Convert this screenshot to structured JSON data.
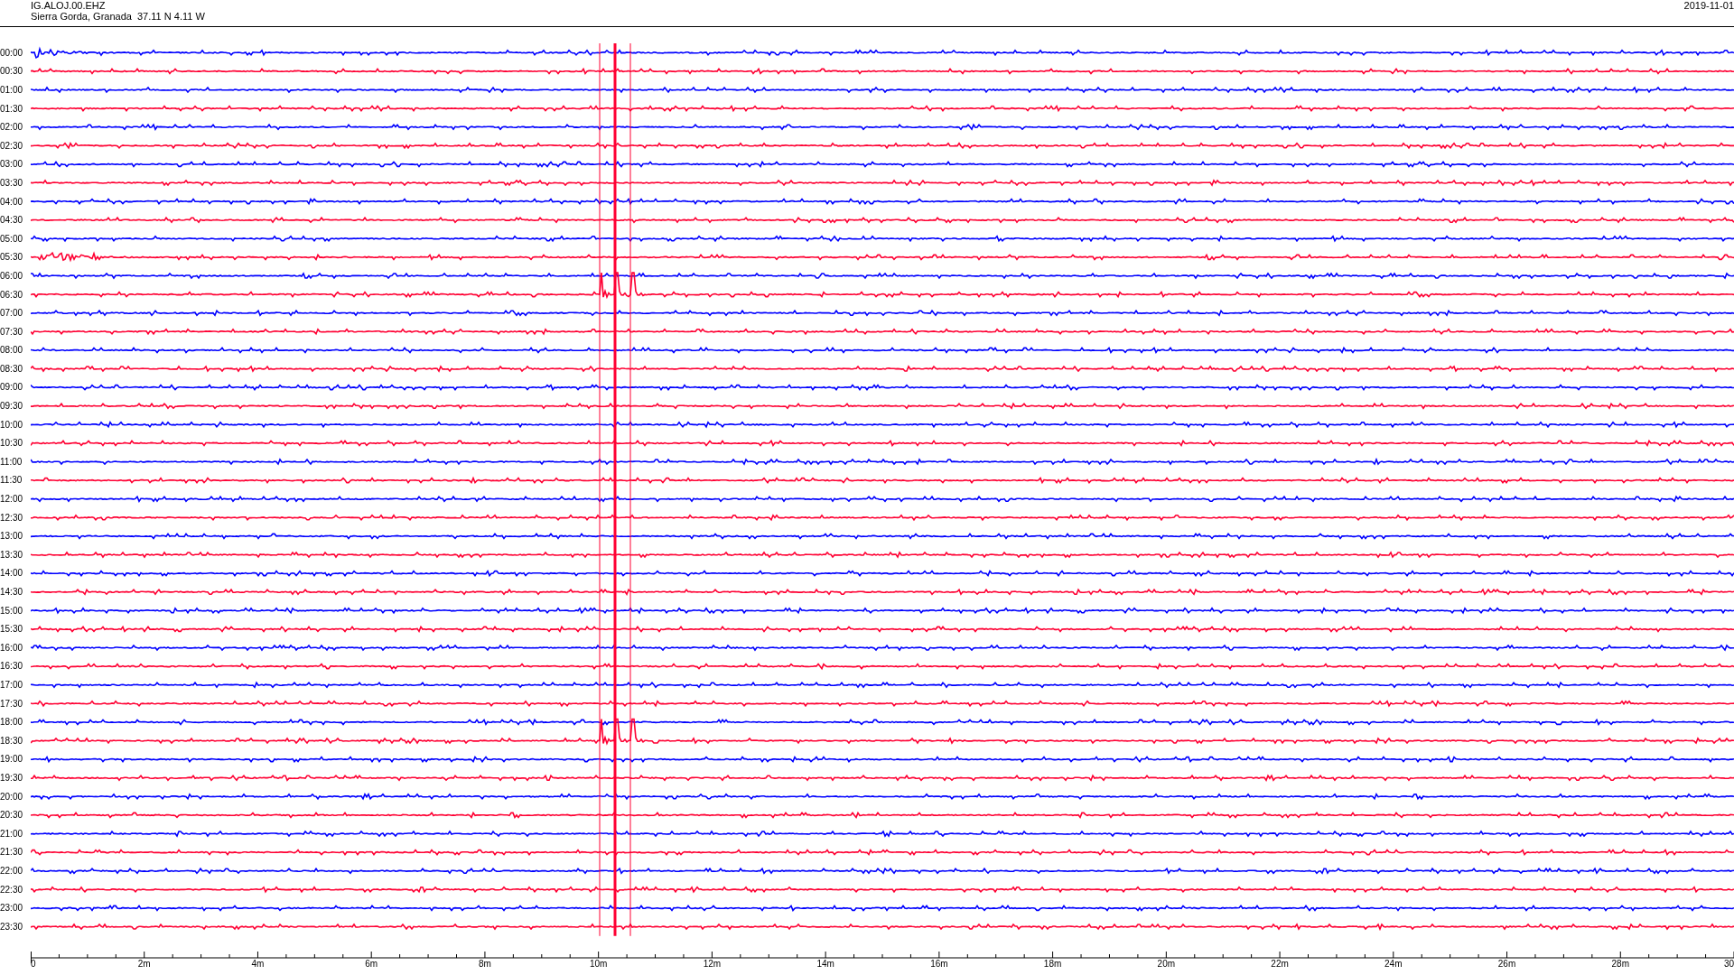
{
  "header": {
    "station": "IG.ALOJ.00.EHZ",
    "location": "Sierra Gorda, Granada  37.11 N 4.11 W",
    "date": "2019-11-01"
  },
  "traces": [
    {
      "label": "00:00",
      "color": "#0000ff"
    },
    {
      "label": "00:30",
      "color": "#ff0033"
    },
    {
      "label": "01:00",
      "color": "#0000ff"
    },
    {
      "label": "01:30",
      "color": "#ff0033"
    },
    {
      "label": "02:00",
      "color": "#0000ff"
    },
    {
      "label": "02:30",
      "color": "#ff0033"
    },
    {
      "label": "03:00",
      "color": "#0000ff"
    },
    {
      "label": "03:30",
      "color": "#ff0033"
    },
    {
      "label": "04:00",
      "color": "#0000ff"
    },
    {
      "label": "04:30",
      "color": "#ff0033"
    },
    {
      "label": "05:00",
      "color": "#0000ff"
    },
    {
      "label": "05:30",
      "color": "#ff0033"
    },
    {
      "label": "06:00",
      "color": "#0000ff"
    },
    {
      "label": "06:30",
      "color": "#ff0033"
    },
    {
      "label": "07:00",
      "color": "#0000ff"
    },
    {
      "label": "07:30",
      "color": "#ff0033"
    },
    {
      "label": "08:00",
      "color": "#0000ff"
    },
    {
      "label": "08:30",
      "color": "#ff0033"
    },
    {
      "label": "09:00",
      "color": "#0000ff"
    },
    {
      "label": "09:30",
      "color": "#ff0033"
    },
    {
      "label": "10:00",
      "color": "#0000ff"
    },
    {
      "label": "10:30",
      "color": "#ff0033"
    },
    {
      "label": "11:00",
      "color": "#0000ff"
    },
    {
      "label": "11:30",
      "color": "#ff0033"
    },
    {
      "label": "12:00",
      "color": "#0000ff"
    },
    {
      "label": "12:30",
      "color": "#ff0033"
    },
    {
      "label": "13:00",
      "color": "#0000ff"
    },
    {
      "label": "13:30",
      "color": "#ff0033"
    },
    {
      "label": "14:00",
      "color": "#0000ff"
    },
    {
      "label": "14:30",
      "color": "#ff0033"
    },
    {
      "label": "15:00",
      "color": "#0000ff"
    },
    {
      "label": "15:30",
      "color": "#ff0033"
    },
    {
      "label": "16:00",
      "color": "#0000ff"
    },
    {
      "label": "16:30",
      "color": "#ff0033"
    },
    {
      "label": "17:00",
      "color": "#0000ff"
    },
    {
      "label": "17:30",
      "color": "#ff0033"
    },
    {
      "label": "18:00",
      "color": "#0000ff"
    },
    {
      "label": "18:30",
      "color": "#ff0033"
    },
    {
      "label": "19:00",
      "color": "#0000ff"
    },
    {
      "label": "19:30",
      "color": "#ff0033"
    },
    {
      "label": "20:00",
      "color": "#0000ff"
    },
    {
      "label": "20:30",
      "color": "#ff0033"
    },
    {
      "label": "21:00",
      "color": "#0000ff"
    },
    {
      "label": "21:30",
      "color": "#ff0033"
    },
    {
      "label": "22:00",
      "color": "#0000ff"
    },
    {
      "label": "22:30",
      "color": "#ff0033"
    },
    {
      "label": "23:00",
      "color": "#0000ff"
    },
    {
      "label": "23:30",
      "color": "#ff0033"
    }
  ],
  "x_axis": {
    "ticks": [
      "0",
      "2m",
      "4m",
      "6m",
      "8m",
      "10m",
      "12m",
      "14m",
      "16m",
      "18m",
      "20m",
      "22m",
      "24m",
      "26m",
      "28m",
      "30"
    ]
  }
}
